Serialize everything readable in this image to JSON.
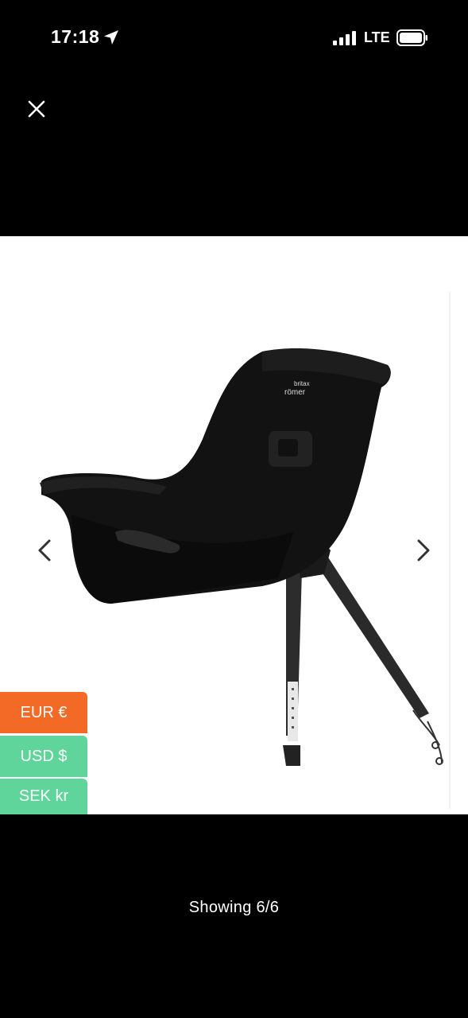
{
  "status_bar": {
    "time": "17:18",
    "network": "LTE"
  },
  "icons": {
    "location": "location-arrow-icon",
    "signal": "cellular-signal-icon",
    "battery": "battery-icon",
    "close": "close-icon",
    "prev": "chevron-left-icon",
    "next": "chevron-right-icon"
  },
  "product": {
    "brand_line1": "britax",
    "brand_line2": "römer"
  },
  "currencies": [
    {
      "label": "EUR €",
      "active": true
    },
    {
      "label": "USD $",
      "active": false
    },
    {
      "label": "SEK kr",
      "active": false
    }
  ],
  "colors": {
    "active_currency": "#f26a26",
    "inactive_currency": "#5fd49b"
  },
  "gallery": {
    "counter": "Showing 6/6"
  }
}
